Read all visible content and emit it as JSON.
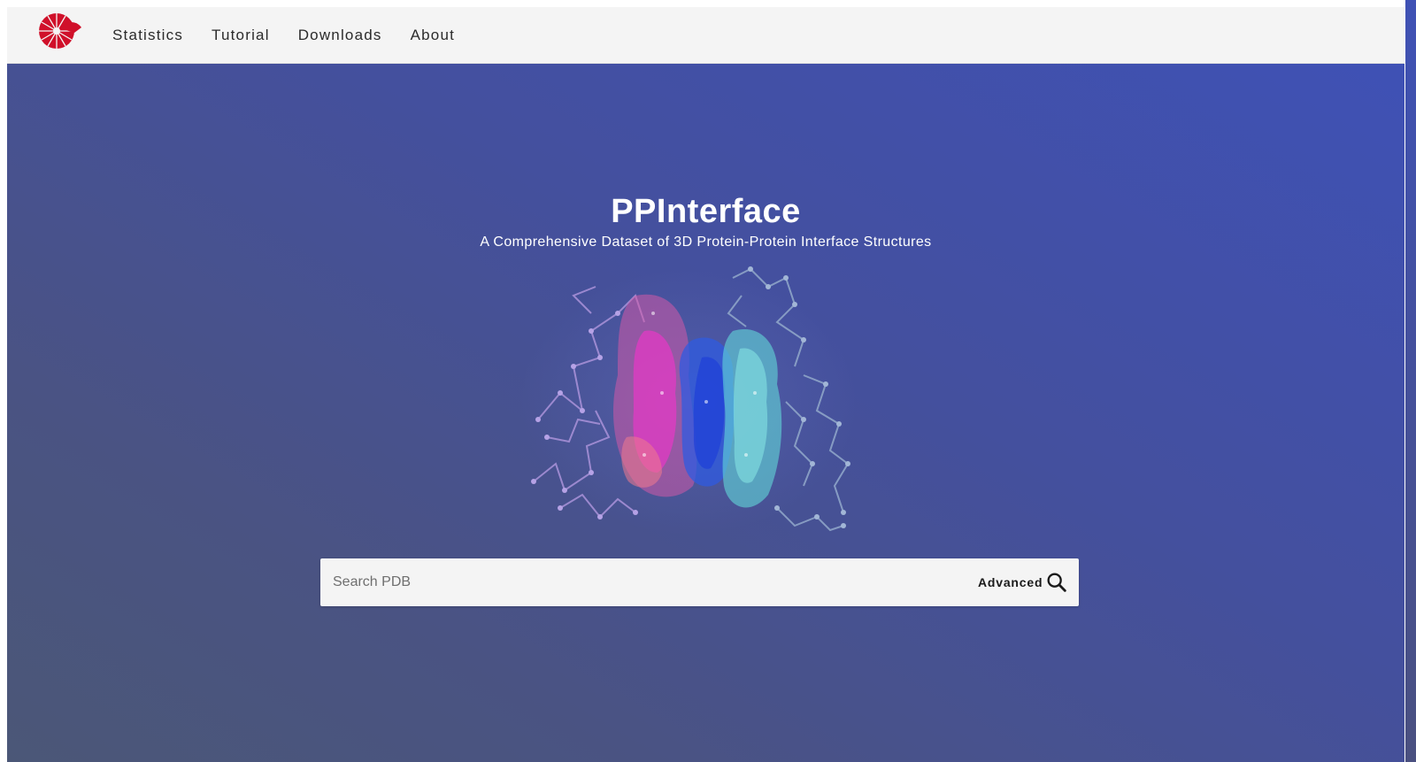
{
  "nav": {
    "logo_icon": "red-spiral-logo-icon",
    "items": [
      {
        "label": "Statistics"
      },
      {
        "label": "Tutorial"
      },
      {
        "label": "Downloads"
      },
      {
        "label": "About"
      }
    ]
  },
  "hero": {
    "title": "PPInterface",
    "subtitle": "A Comprehensive Dataset of 3D Protein-Protein Interface Structures",
    "image_icon": "protein-structure-illustration"
  },
  "search": {
    "placeholder": "Search PDB",
    "value": "",
    "advanced_label": "Advanced",
    "search_icon": "search-icon"
  },
  "colors": {
    "navbar_bg": "#f4f4f4",
    "hero_top": "#3f51b5",
    "hero_bottom": "#4b5777",
    "logo_red": "#d0102a",
    "text_white": "#ffffff"
  }
}
